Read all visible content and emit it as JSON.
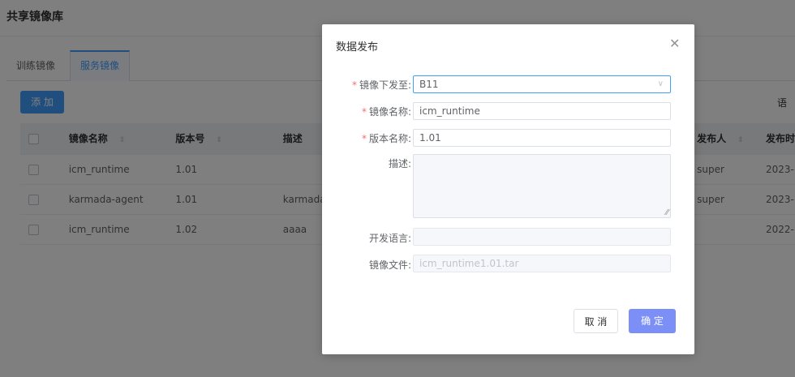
{
  "page": {
    "title": "共享镜像库",
    "tabs": [
      {
        "label": "训练镜像",
        "active": false
      },
      {
        "label": "服务镜像",
        "active": true
      }
    ],
    "add_button": "添 加",
    "right_label": "语"
  },
  "table": {
    "columns": [
      "",
      "镜像名称",
      "版本号",
      "描述",
      "发布人",
      "发布时"
    ],
    "rows": [
      {
        "name": "icm_runtime",
        "version": "1.01",
        "desc": "",
        "publisher": "super",
        "time": "2023-"
      },
      {
        "name": "karmada-agent",
        "version": "1.01",
        "desc": "karmada",
        "publisher": "super",
        "time": "2023-"
      },
      {
        "name": "icm_runtime",
        "version": "1.02",
        "desc": "aaaa",
        "publisher": "",
        "time": "2022-"
      }
    ]
  },
  "dialog": {
    "title": "数据发布",
    "close_icon": "close-icon",
    "fields": {
      "target": {
        "label": "镜像下发至:",
        "value": "B11",
        "required": true
      },
      "image_name": {
        "label": "镜像名称:",
        "value": "icm_runtime",
        "required": true
      },
      "version_name": {
        "label": "版本名称:",
        "value": "1.01",
        "required": true
      },
      "description": {
        "label": "描述:",
        "value": ""
      },
      "language": {
        "label": "开发语言:",
        "value": ""
      },
      "image_file": {
        "label": "镜像文件:",
        "value": "icm_runtime1.01.tar"
      }
    },
    "cancel_label": "取 消",
    "ok_label": "确 定"
  },
  "colors": {
    "primary": "#409eff",
    "ok_button": "#7b8ff7",
    "required": "#f56c6c"
  }
}
